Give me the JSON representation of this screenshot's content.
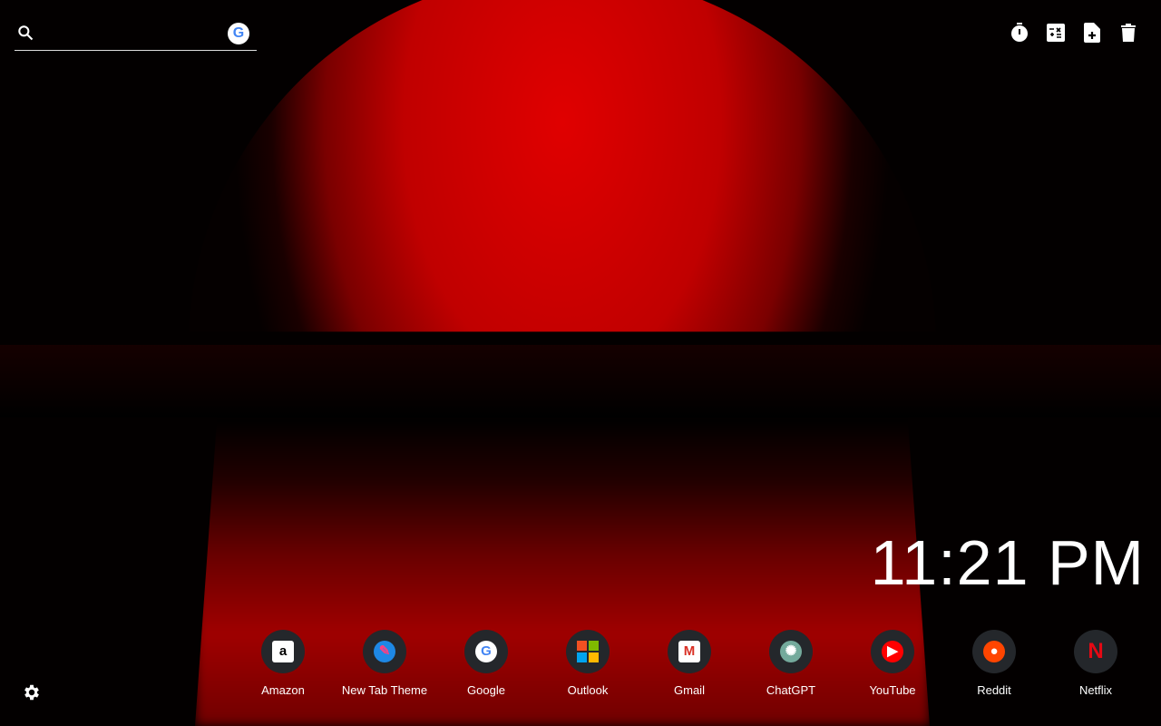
{
  "search": {
    "placeholder": ""
  },
  "clock": {
    "time": "11:21 PM"
  },
  "toolbar": [
    {
      "icon": "timer-icon"
    },
    {
      "icon": "calculator-icon"
    },
    {
      "icon": "new-note-icon"
    },
    {
      "icon": "trash-icon"
    }
  ],
  "shortcuts": [
    {
      "label": "Amazon",
      "glyph": "a",
      "bg": "#ffffff",
      "fg": "#000000"
    },
    {
      "label": "New Tab Theme",
      "glyph": "✎",
      "bg": "#1e88e5",
      "fg": "#ff4081"
    },
    {
      "label": "Google",
      "glyph": "G",
      "bg": "#ffffff",
      "fg": "#4285f4"
    },
    {
      "label": "Outlook",
      "glyph": "",
      "bg": "",
      "fg": ""
    },
    {
      "label": "Gmail",
      "glyph": "M",
      "bg": "#ffffff",
      "fg": "#d93025"
    },
    {
      "label": "ChatGPT",
      "glyph": "✺",
      "bg": "#74aa9c",
      "fg": "#ffffff"
    },
    {
      "label": "YouTube",
      "glyph": "▶",
      "bg": "#ff0000",
      "fg": "#ffffff"
    },
    {
      "label": "Reddit",
      "glyph": "●",
      "bg": "#ff4500",
      "fg": "#ffffff"
    },
    {
      "label": "Netflix",
      "glyph": "N",
      "bg": "transparent",
      "fg": "#e50914"
    }
  ]
}
